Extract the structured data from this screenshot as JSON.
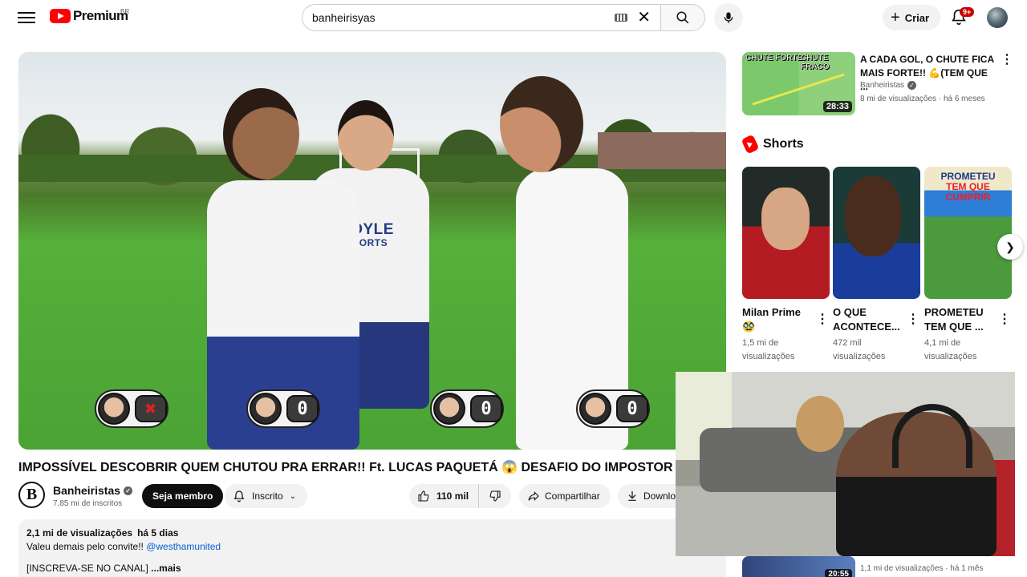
{
  "header": {
    "logo_text": "Premium",
    "logo_region": "BR",
    "search_value": "banheirisyas",
    "create_label": "Criar",
    "notifications_badge": "9+"
  },
  "video": {
    "title": "IMPOSSÍVEL DESCOBRIR QUEM CHUTOU PRA ERRAR!! Ft. LUCAS PAQUETÁ 😱 DESAFIO DO IMPOSTOR",
    "jersey_line1": "BOYLE",
    "jersey_line2": "SPORTS",
    "scores": [
      "✖",
      "0",
      "0",
      "0"
    ]
  },
  "channel": {
    "avatar_letter": "B",
    "name": "Banheiristas",
    "subscribers": "7,85 mi de inscritos",
    "member_label": "Seja membro",
    "subscribed_label": "Inscrito"
  },
  "actions": {
    "likes": "110 mil",
    "share_label": "Compartilhar",
    "download_label": "Download"
  },
  "description": {
    "views": "2,1 mi de visualizações",
    "age": "há 5 dias",
    "line1_text": "Valeu demais pelo convite!! ",
    "line1_link": "@westhamunited",
    "line2": "[INSCREVA-SE NO CANAL] ",
    "more_label": "...mais"
  },
  "sidebar": {
    "recommended": {
      "thumb_label_left": "CHUTE FORTE",
      "thumb_label_right": "CHUTE FRACO",
      "duration": "28:33",
      "title": "A CADA GOL, O CHUTE FICA MAIS FORTE!! 💪(TEM QUE ...",
      "channel": "Banheiristas",
      "views": "8 mi de visualizações",
      "age": "há 6 meses"
    },
    "shorts_heading": "Shorts",
    "shorts": [
      {
        "title": "Milan Prime 🥸",
        "views_line1": "1,5 mi de",
        "views_line2": "visualizações"
      },
      {
        "title": "O QUE ACONTECE...",
        "views_line1": "472 mil",
        "views_line2": "visualizações"
      },
      {
        "title": "PROMETEU TEM QUE ...",
        "views_line1": "4,1 mi de",
        "views_line2": "visualizações",
        "thumb_text1": "PROMETEU",
        "thumb_text2": "TEM QUE",
        "thumb_text3": "CUMPRIR"
      }
    ],
    "bottom_rec": {
      "duration": "20:55",
      "meta": "1,1 mi de visualizações · há 1 mês"
    }
  },
  "colors": {
    "brand_red": "#ff0000",
    "link_blue": "#065fd4",
    "text_secondary": "#606060"
  }
}
